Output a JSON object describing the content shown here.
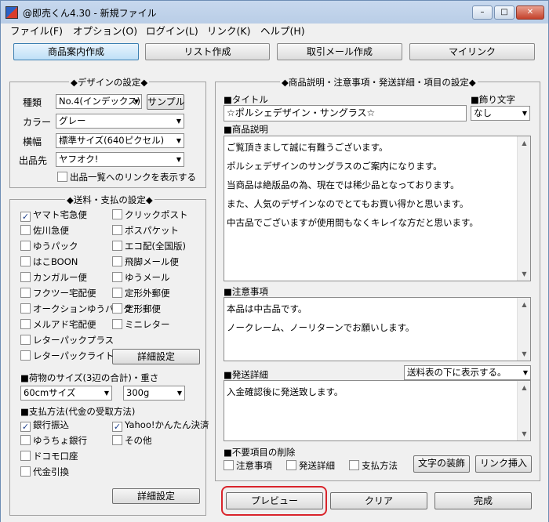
{
  "window": {
    "title": "@即売くん4.30 - 新規ファイル",
    "min": "–",
    "max": "□",
    "close": "✕"
  },
  "menu": [
    "ファイル(F)",
    "オプション(O)",
    "ログイン(L)",
    "リンク(K)",
    "ヘルプ(H)"
  ],
  "tabs": [
    "商品案内作成",
    "リスト作成",
    "取引メール作成",
    "マイリンク"
  ],
  "design": {
    "legend": "◆デザインの設定◆",
    "type_label": "種類",
    "type_value": "No.4(インデックス)",
    "sample_btn": "サンプル",
    "color_label": "カラー",
    "color_value": "グレー",
    "width_label": "横幅",
    "width_value": "標準サイズ(640ピクセル)",
    "dest_label": "出品先",
    "dest_value": "ヤフオク!",
    "list_link": "出品一覧へのリンクを表示する"
  },
  "shipping": {
    "legend": "◆送料・支払の設定◆",
    "left": [
      {
        "label": "ヤマト宅急便",
        "checked": true
      },
      {
        "label": "佐川急便",
        "checked": false
      },
      {
        "label": "ゆうパック",
        "checked": false
      },
      {
        "label": "はこBOON",
        "checked": false
      },
      {
        "label": "カンガルー便",
        "checked": false
      },
      {
        "label": "フクツー宅配便",
        "checked": false
      },
      {
        "label": "オークションゆうパック",
        "checked": false
      },
      {
        "label": "メルアド宅配便",
        "checked": false
      },
      {
        "label": "レターパックプラス",
        "checked": false
      },
      {
        "label": "レターパックライト",
        "checked": false
      }
    ],
    "right": [
      {
        "label": "クリックポスト",
        "checked": false
      },
      {
        "label": "ポスパケット",
        "checked": false
      },
      {
        "label": "エコ配(全国版)",
        "checked": false
      },
      {
        "label": "飛脚メール便",
        "checked": false
      },
      {
        "label": "ゆうメール",
        "checked": false
      },
      {
        "label": "定形外郵便",
        "checked": false
      },
      {
        "label": "定形郵便",
        "checked": false
      },
      {
        "label": "ミニレター",
        "checked": false
      }
    ],
    "detail_btn": "詳細設定",
    "size_title": "■荷物のサイズ(3辺の合計)・重さ",
    "size_value": "60cmサイズ",
    "weight_value": "300g",
    "pay_title": "■支払方法(代金の受取方法)",
    "pay_left": [
      {
        "label": "銀行振込",
        "checked": true
      },
      {
        "label": "ゆうちょ銀行",
        "checked": false
      },
      {
        "label": "ドコモ口座",
        "checked": false
      },
      {
        "label": "代金引換",
        "checked": false
      }
    ],
    "pay_right": [
      {
        "label": "Yahoo!かんたん決済",
        "checked": true
      },
      {
        "label": "その他",
        "checked": false
      }
    ],
    "pay_detail_btn": "詳細設定"
  },
  "product": {
    "legend": "◆商品説明・注意事項・発送詳細・項目の設定◆",
    "title_label": "■タイトル",
    "title_value": "☆ポルシェデザイン・サングラス☆",
    "deco_label": "■飾り文字",
    "deco_value": "なし",
    "desc_label": "■商品説明",
    "desc_lines": [
      "ご覧頂きまして誠に有難うございます。",
      "ポルシェデザインのサングラスのご案内になります。",
      "当商品は絶版品の為、現在では稀少品となっております。",
      "また、人気のデザインなのでとてもお買い得かと思います。",
      "中古品でございますが使用間もなくキレイな方だと思います。"
    ],
    "notes_label": "■注意事項",
    "notes_lines": [
      "本品は中古品です。",
      "ノークレーム、ノーリターンでお願いします。"
    ],
    "ship_label": "■発送詳細",
    "ship_pos_value": "送料表の下に表示する。",
    "ship_lines": [
      "入金確認後に発送致します。"
    ],
    "unneeded_label": "■不要項目の削除",
    "unneeded": [
      {
        "label": "注意事項",
        "checked": false
      },
      {
        "label": "発送詳細",
        "checked": false
      },
      {
        "label": "支払方法",
        "checked": false
      }
    ],
    "deco_btn": "文字の装飾",
    "link_btn": "リンク挿入"
  },
  "bottom": {
    "preview": "プレビュー",
    "clear": "クリア",
    "finish": "完成"
  },
  "colors": {
    "highlight": "#d9242b",
    "check": "#1c3e8a"
  }
}
